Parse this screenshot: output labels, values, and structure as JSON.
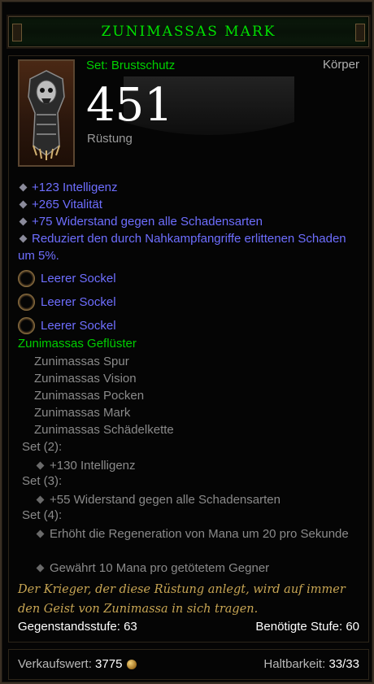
{
  "item": {
    "name": "Zunimassas Mark",
    "set_type": "Set: Brustschutz",
    "slot": "Körper",
    "armor_value": "451",
    "armor_label": "Rüstung",
    "quality_color": "#00d000"
  },
  "affixes": [
    "+123 Intelligenz",
    "+265 Vitalität",
    "+75 Widerstand gegen alle Schadensarten",
    "Reduziert den durch Nahkampfangriffe erlittenen Schaden um 5%."
  ],
  "sockets": [
    "Leerer Sockel",
    "Leerer Sockel",
    "Leerer Sockel"
  ],
  "set": {
    "name": "Zunimassas Geflüster",
    "pieces": [
      "Zunimassas Spur",
      "Zunimassas Vision",
      "Zunimassas Pocken",
      "Zunimassas Mark",
      "Zunimassas Schädelkette"
    ],
    "bonuses": [
      {
        "header": "Set (2):",
        "lines": [
          "+130 Intelligenz"
        ]
      },
      {
        "header": "Set (3):",
        "lines": [
          "+55 Widerstand gegen alle Schadensarten"
        ]
      },
      {
        "header": "Set (4):",
        "lines": [
          "Erhöht die Regeneration von Mana um 20 pro Sekunde",
          "Gewährt 10 Mana pro getötetem Gegner"
        ]
      }
    ]
  },
  "flavor": "Der Krieger, der diese Rüstung anlegt, wird auf immer den Geist von Zunimassa in sich tragen.",
  "footer": {
    "item_level_label": "Gegenstandsstufe:",
    "item_level": "63",
    "required_level_label": "Benötigte Stufe:",
    "required_level": "60",
    "sell_label": "Verkaufswert:",
    "sell_value": "3775",
    "durability_label": "Haltbarkeit:",
    "durability_value": "33/33"
  }
}
